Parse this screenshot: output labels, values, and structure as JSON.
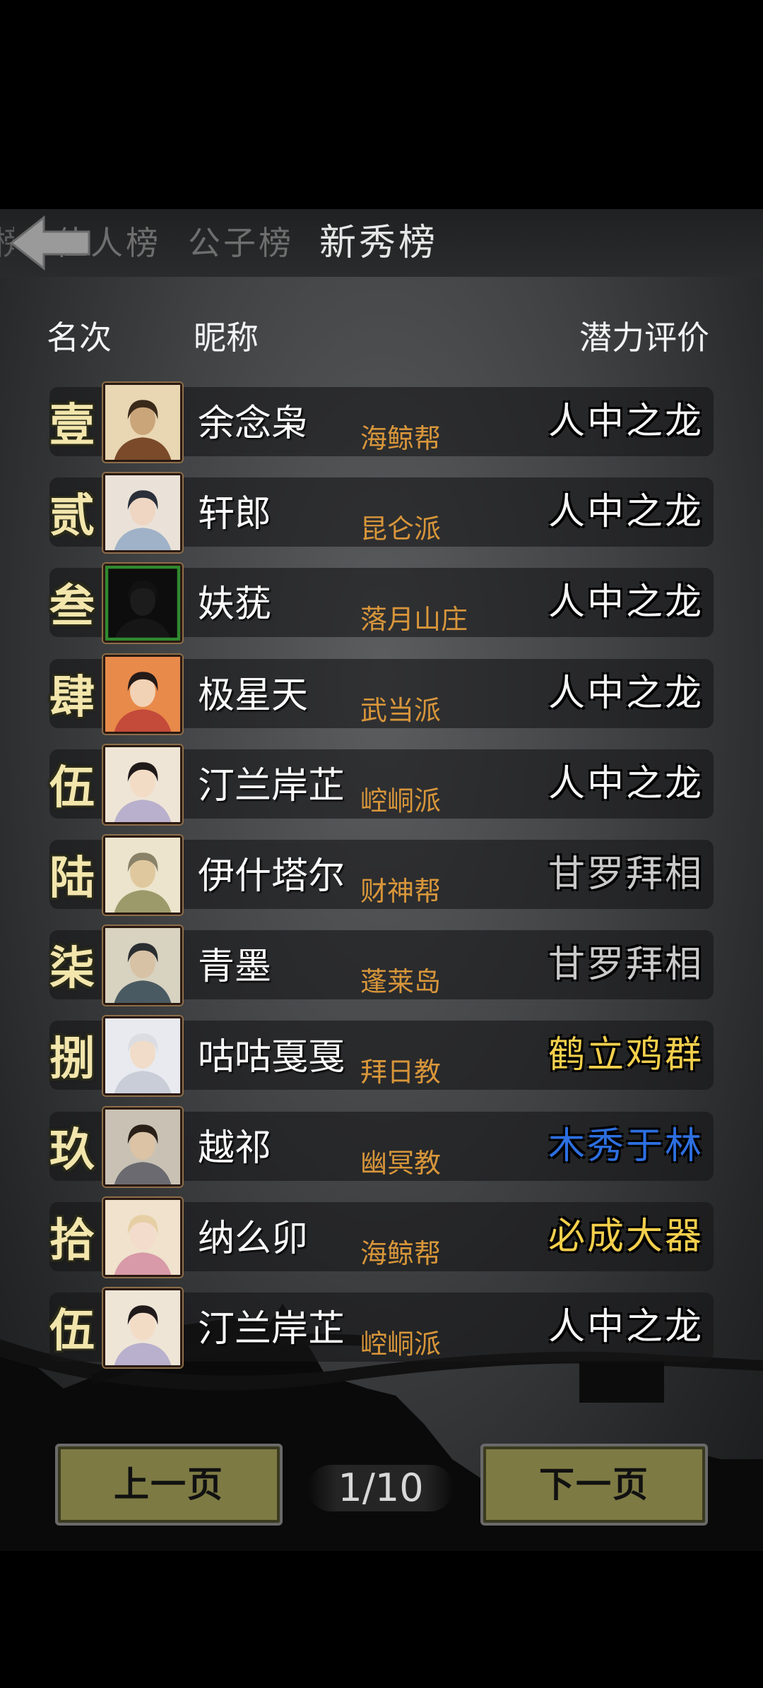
{
  "tabs": {
    "prev_partial": "榜",
    "beauty": "佳人榜",
    "gongzi": "公子榜",
    "xinxiu": "新秀榜"
  },
  "columns": {
    "rank": "名次",
    "nickname": "昵称",
    "potential": "潜力评价"
  },
  "colors": {
    "rank_text": "#f3e6ac",
    "sect_text": "#d8963a",
    "tier_white": "#f5f5f5",
    "tier_gray": "#c9c9c9",
    "tier_gold": "#f3cf4c",
    "tier_blue": "#2d6fe0",
    "button_fill": "#7d7a44"
  },
  "rows": [
    {
      "rank": "壹",
      "nickname": "余念枭",
      "sect": "海鲸帮",
      "potential": "人中之龙",
      "tier": "white",
      "avatar_icon": "bearded-warrior-avatar"
    },
    {
      "rank": "贰",
      "nickname": "轩郎",
      "sect": "昆仑派",
      "potential": "人中之龙",
      "tier": "white",
      "avatar_icon": "swordswoman-avatar"
    },
    {
      "rank": "叁",
      "nickname": "妋莸",
      "sect": "落月山庄",
      "potential": "人中之龙",
      "tier": "white",
      "avatar_icon": "shadow-avatar"
    },
    {
      "rank": "肆",
      "nickname": "极星天",
      "sect": "武当派",
      "potential": "人中之龙",
      "tier": "white",
      "avatar_icon": "fire-maiden-avatar"
    },
    {
      "rank": "伍",
      "nickname": "汀兰岸芷",
      "sect": "崆峒派",
      "potential": "人中之龙",
      "tier": "white",
      "avatar_icon": "lady-avatar"
    },
    {
      "rank": "陆",
      "nickname": "伊什塔尔",
      "sect": "财神帮",
      "potential": "甘罗拜相",
      "tier": "gray",
      "avatar_icon": "elder-monk-avatar"
    },
    {
      "rank": "柒",
      "nickname": "青墨",
      "sect": "蓬莱岛",
      "potential": "甘罗拜相",
      "tier": "gray",
      "avatar_icon": "masked-swordsman-avatar"
    },
    {
      "rank": "捌",
      "nickname": "咕咕戛戛",
      "sect": "拜日教",
      "potential": "鹤立鸡群",
      "tier": "gold",
      "avatar_icon": "white-haired-avatar"
    },
    {
      "rank": "玖",
      "nickname": "越祁",
      "sect": "幽冥教",
      "potential": "木秀于林",
      "tier": "blue",
      "avatar_icon": "young-scholar-avatar"
    },
    {
      "rank": "拾",
      "nickname": "纳么卯",
      "sect": "海鲸帮",
      "potential": "必成大器",
      "tier": "gold",
      "avatar_icon": "pigtail-girl-avatar"
    },
    {
      "rank": "伍",
      "nickname": "汀兰岸芷",
      "sect": "崆峒派",
      "potential": "人中之龙",
      "tier": "white",
      "avatar_icon": "lady-avatar"
    }
  ],
  "pagination": {
    "prev_label": "上一页",
    "next_label": "下一页",
    "indicator": "1/10",
    "current_page": 1,
    "total_pages": 10
  }
}
